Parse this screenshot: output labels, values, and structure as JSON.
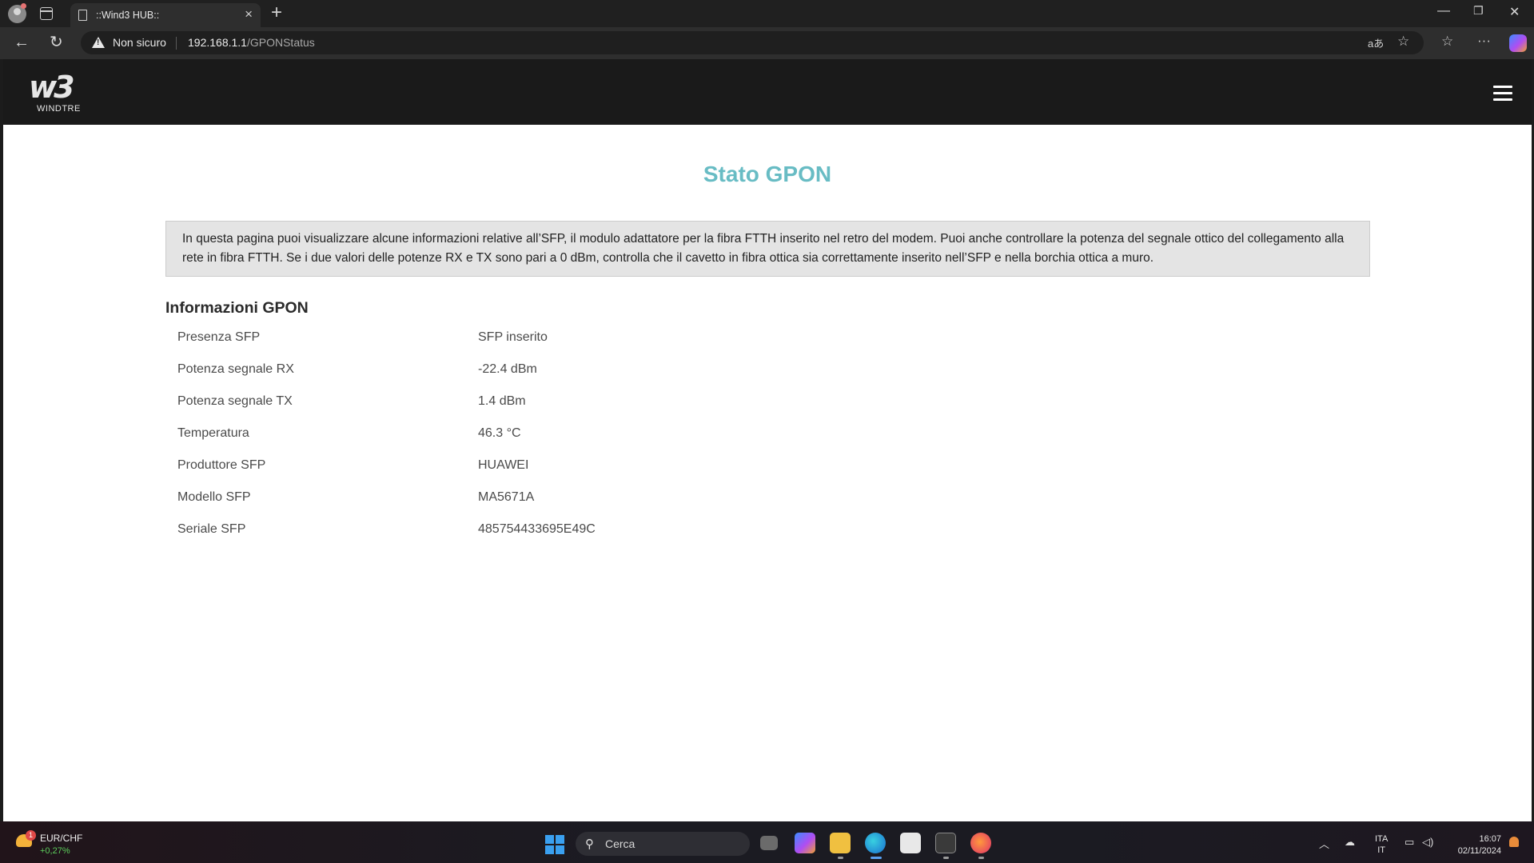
{
  "browser": {
    "tab_title": "::Wind3 HUB::",
    "security_label": "Non sicuro",
    "url_host": "192.168.1.1",
    "url_path": "/GPONStatus"
  },
  "site": {
    "logo_text": "WINDTRE",
    "page_title": "Stato GPON",
    "intro_text": "In questa pagina puoi visualizzare alcune informazioni relative all’SFP, il modulo adattatore per la fibra FTTH inserito nel retro del modem. Puoi anche controllare la potenza del segnale ottico del collegamento alla rete in fibra FTTH. Se i due valori delle potenze RX e TX sono pari a 0 dBm, controlla che il cavetto in fibra ottica sia correttamente inserito nell’SFP e nella borchia ottica a muro.",
    "section_title": "Informazioni GPON",
    "rows": [
      {
        "label": "Presenza SFP",
        "value": "SFP inserito"
      },
      {
        "label": "Potenza segnale RX",
        "value": "-22.4 dBm"
      },
      {
        "label": "Potenza segnale TX",
        "value": "1.4 dBm"
      },
      {
        "label": "Temperatura",
        "value": "46.3 °C"
      },
      {
        "label": "Produttore SFP",
        "value": "HUAWEI"
      },
      {
        "label": "Modello SFP",
        "value": "MA5671A"
      },
      {
        "label": "Seriale SFP",
        "value": "485754433695E49C"
      }
    ]
  },
  "taskbar": {
    "widget_badge": "1",
    "widget_title": "EUR/CHF",
    "widget_change": "+0,27%",
    "search_placeholder": "Cerca",
    "lang_top": "ITA",
    "lang_bottom": "IT",
    "time": "16:07",
    "date": "02/11/2024"
  },
  "colors": {
    "accent_title": "#68bcc4",
    "header_bg": "#1a1a1a",
    "infobox_bg": "#e4e4e4"
  }
}
